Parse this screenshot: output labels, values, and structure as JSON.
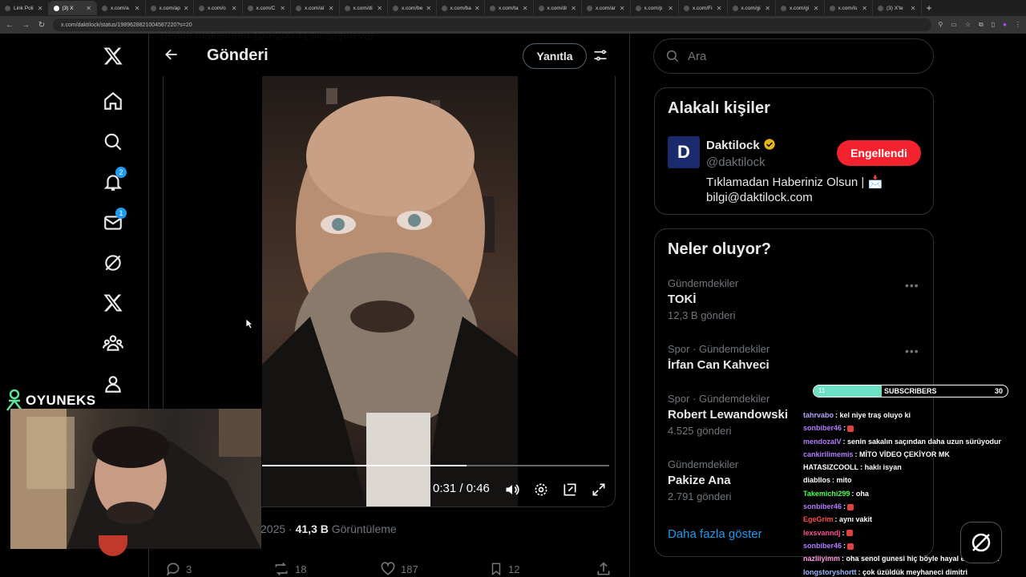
{
  "browser": {
    "tabs": [
      {
        "label": "Link Poli"
      },
      {
        "label": "(3) X"
      },
      {
        "label": "x.com/a"
      },
      {
        "label": "x.com/ap"
      },
      {
        "label": "x.com/o"
      },
      {
        "label": "x.com/C"
      },
      {
        "label": "x.com/al"
      },
      {
        "label": "x.com/di"
      },
      {
        "label": "x.com/be"
      },
      {
        "label": "x.com/ba"
      },
      {
        "label": "x.com/ta"
      },
      {
        "label": "x.com/dr"
      },
      {
        "label": "x.com/ar"
      },
      {
        "label": "x.com/p"
      },
      {
        "label": "x.com/Fi"
      },
      {
        "label": "x.com/gi"
      },
      {
        "label": "x.com/gi"
      },
      {
        "label": "x.com/is"
      },
      {
        "label": "(3) X'te"
      }
    ],
    "url": "x.com/daktilock/status/1989628821004587220?s=20"
  },
  "nav": {
    "notifications_badge": "2",
    "messages_badge": "1"
  },
  "header": {
    "title": "Gönderi",
    "reply_label": "Yanıtla",
    "faded_text": "Benim maksimum 100-200 TL'lik saçım var."
  },
  "video": {
    "time": "0:31 / 0:46",
    "progress_fraction": 0.59
  },
  "post_meta": {
    "date_fragment": "2025",
    "views_count": "41,3 B",
    "views_label": "Görüntüleme"
  },
  "actions": {
    "replies": "3",
    "reposts": "18",
    "likes": "187",
    "bookmarks": "12"
  },
  "overlay": {
    "logo_text": "OYUNEKS"
  },
  "search": {
    "placeholder": "Ara"
  },
  "related": {
    "title": "Alakalı kişiler",
    "name": "Daktilock",
    "handle": "@daktilock",
    "bio_line1": "Tıklamadan Haberiniz Olsun | 📩",
    "bio_line2": "bilgi@daktilock.com",
    "button_label": "Engellendi",
    "avatar_letter": "D"
  },
  "trends": {
    "title": "Neler oluyor?",
    "items": [
      {
        "category": "Gündemdekiler",
        "name": "TOKİ",
        "count": "12,3 B gönderi"
      },
      {
        "category": "Spor · Gündemdekiler",
        "name": "İrfan Can Kahveci",
        "count": ""
      },
      {
        "category": "Spor · Gündemdekiler",
        "name": "Robert Lewandowski",
        "count": "4.525 gönderi"
      },
      {
        "category": "Gündemdekiler",
        "name": "Pakize Ana",
        "count": "2.791 gönderi"
      }
    ],
    "show_more": "Daha fazla göster"
  },
  "subbar": {
    "left": "11",
    "label": "SUBSCRIBERS",
    "right": "30",
    "fill_fraction": 0.35
  },
  "chat": [
    {
      "user": "tahrvabo",
      "color": "#b9a6ff",
      "text": ": kel niye traş oluyo ki"
    },
    {
      "user": "sonbiber46",
      "color": "#b57cff",
      "text": ":"
    },
    {
      "user": "mendozalV",
      "color": "#b57cff",
      "text": ": senin sakalın saçından daha uzun sürüyodur"
    },
    {
      "user": "cankirilimemis",
      "color": "#b57cff",
      "text": ": MİTO VİDEO ÇEKİYOR MK"
    },
    {
      "user": "HATASIZCOOLL",
      "color": "#ffffff",
      "text": ": haklı isyan"
    },
    {
      "user": "diabllos",
      "color": "#ffffff",
      "text": ": mito"
    },
    {
      "user": "Takemichi299",
      "color": "#4cff4c",
      "text": ": oha"
    },
    {
      "user": "sonbiber46",
      "color": "#b57cff",
      "text": ":"
    },
    {
      "user": "EgeGrim",
      "color": "#ff4d4d",
      "text": ": aynı vakit"
    },
    {
      "user": "lexsvanndj",
      "color": "#ff4d9a",
      "text": ":"
    },
    {
      "user": "sonbiber46",
      "color": "#b57cff",
      "text": ":"
    },
    {
      "user": "nazliiyimm",
      "color": "#ff9ae0",
      "text": ": oha senol gunesi hiç böyle hayal etmiyodum"
    },
    {
      "user": "longstoryshortt",
      "color": "#9ab8ff",
      "text": ": çok üzüldük meyhaneci dimitri"
    }
  ]
}
